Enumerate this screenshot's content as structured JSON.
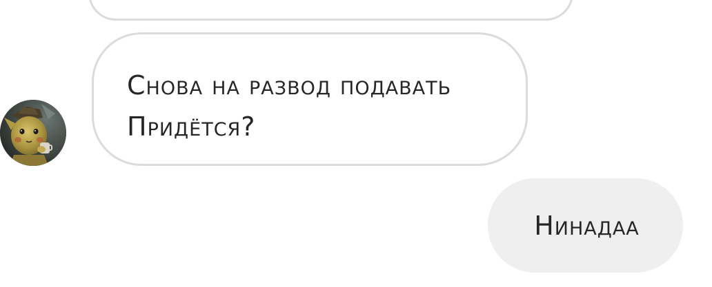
{
  "conversation": {
    "incoming_message": {
      "lines": [
        "Снова на развод подавать",
        "Придётся?"
      ]
    },
    "outgoing_message": {
      "text": "Нинадаа"
    },
    "avatar_icon": "pikachu-detective-avatar-icon"
  },
  "colors": {
    "incoming_bubble_border": "#dbdbdb",
    "outgoing_bubble_bg": "#efefef",
    "text": "#262626"
  }
}
